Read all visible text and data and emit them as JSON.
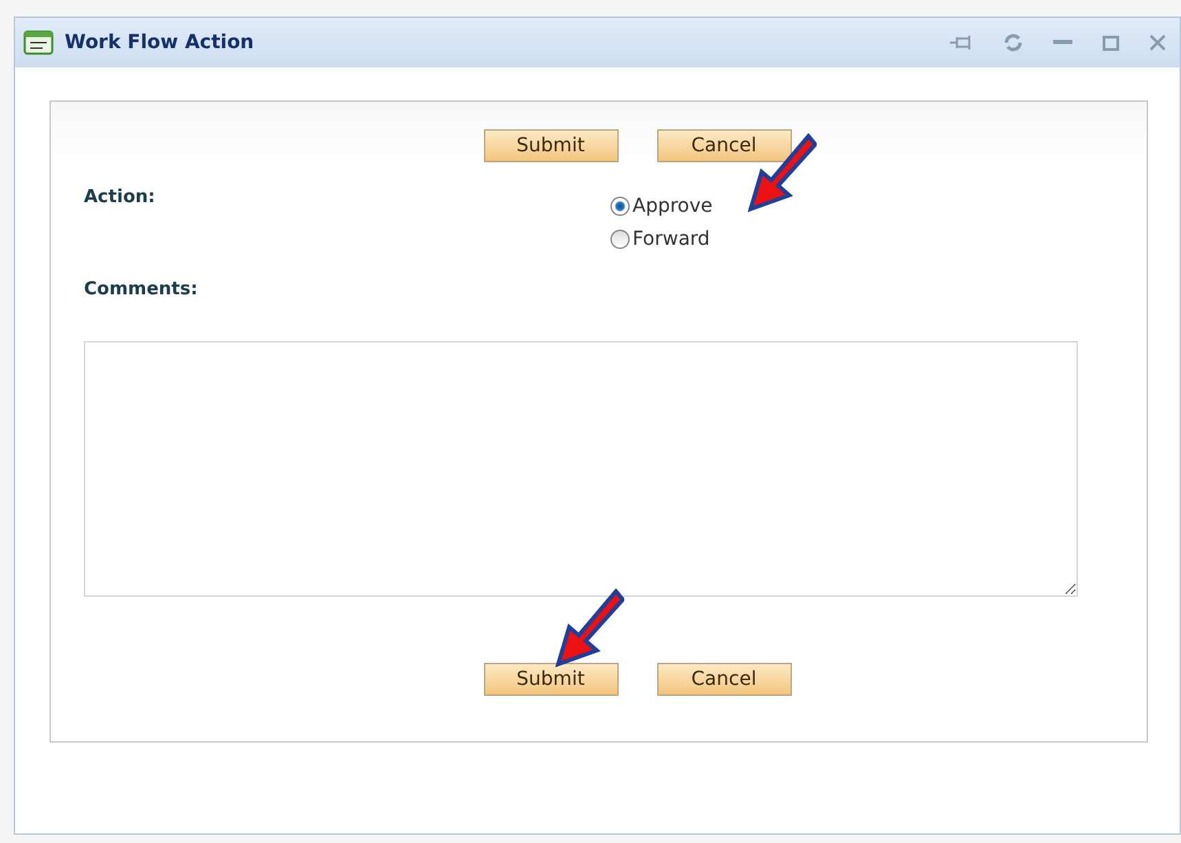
{
  "window": {
    "title": "Work Flow Action"
  },
  "top_buttons": [
    "Submit",
    "Cancel"
  ],
  "action": {
    "label": "Action:",
    "options": [
      {
        "label": "Approve",
        "selected": true
      },
      {
        "label": "Forward",
        "selected": false
      }
    ]
  },
  "comments": {
    "label": "Comments:"
  },
  "bottom_buttons": [
    "Submit",
    "Cancel"
  ]
}
